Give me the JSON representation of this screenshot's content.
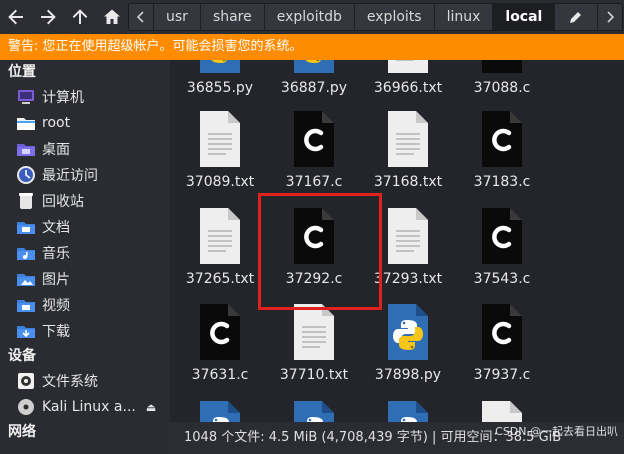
{
  "path": {
    "segments": [
      "usr",
      "share",
      "exploitdb",
      "exploits",
      "linux",
      "local"
    ],
    "active": "local"
  },
  "warning": "警告: 您正在使用超级帐户。可能会损害您的系统。",
  "sidebar": {
    "places_header": "位置",
    "places": [
      {
        "label": "计算机",
        "icon": "computer-icon"
      },
      {
        "label": "root",
        "icon": "home-folder-icon"
      },
      {
        "label": "桌面",
        "icon": "desktop-folder-icon"
      },
      {
        "label": "最近访问",
        "icon": "recent-icon"
      },
      {
        "label": "回收站",
        "icon": "trash-icon"
      },
      {
        "label": "文档",
        "icon": "documents-folder-icon"
      },
      {
        "label": "音乐",
        "icon": "music-folder-icon"
      },
      {
        "label": "图片",
        "icon": "pictures-folder-icon"
      },
      {
        "label": "视频",
        "icon": "videos-folder-icon"
      },
      {
        "label": "下载",
        "icon": "downloads-folder-icon"
      }
    ],
    "devices_header": "设备",
    "devices": [
      {
        "label": "文件系统",
        "icon": "drive-icon"
      },
      {
        "label": "Kali Linux a...",
        "icon": "disc-icon"
      }
    ],
    "network_header": "网络"
  },
  "files": [
    {
      "name": "36855.py",
      "kind": "py"
    },
    {
      "name": "36887.py",
      "kind": "py"
    },
    {
      "name": "36966.txt",
      "kind": "txt"
    },
    {
      "name": "37088.c",
      "kind": "c"
    },
    {
      "name": "37089.txt",
      "kind": "txt"
    },
    {
      "name": "37167.c",
      "kind": "c"
    },
    {
      "name": "37168.txt",
      "kind": "txt"
    },
    {
      "name": "37183.c",
      "kind": "c"
    },
    {
      "name": "37265.txt",
      "kind": "txt"
    },
    {
      "name": "37292.c",
      "kind": "c"
    },
    {
      "name": "37293.txt",
      "kind": "txt"
    },
    {
      "name": "37543.c",
      "kind": "c"
    },
    {
      "name": "37631.c",
      "kind": "c"
    },
    {
      "name": "37710.txt",
      "kind": "txt"
    },
    {
      "name": "37898.py",
      "kind": "py"
    },
    {
      "name": "37937.c",
      "kind": "c"
    }
  ],
  "status": "1048 个文件: 4.5 MiB (4,708,439 字节) | 可用空间：38.5 GiB",
  "watermark": "CSDN @一起去看日出叭",
  "colors": {
    "warning": "#ff8c00",
    "highlight": "#e0221e",
    "python_blue": "#2f6db5",
    "python_yellow": "#f5c518"
  }
}
